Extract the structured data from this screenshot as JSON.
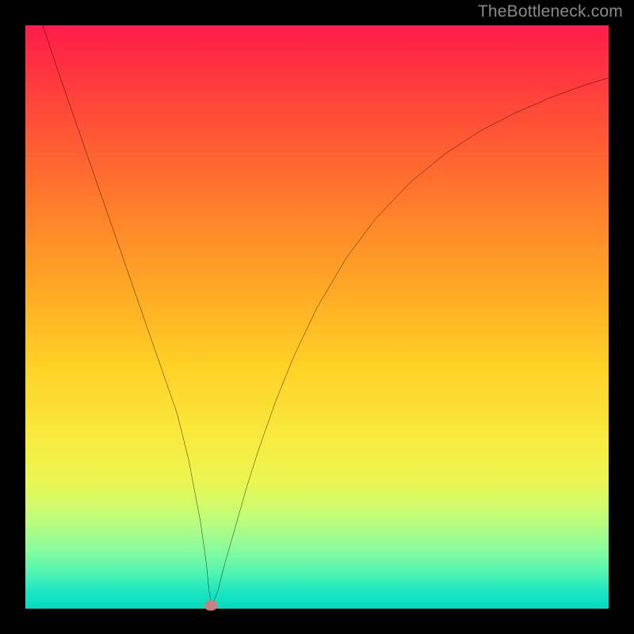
{
  "watermark": "TheBottleneck.com",
  "chart_data": {
    "type": "line",
    "title": "",
    "xlabel": "",
    "ylabel": "",
    "xlim": [
      0,
      100
    ],
    "ylim": [
      0,
      100
    ],
    "series": [
      {
        "name": "curve",
        "x": [
          3,
          6,
          10,
          14,
          18,
          22,
          26,
          28,
          30,
          31,
          31.5,
          32,
          33,
          34,
          36,
          38,
          40,
          43,
          46,
          50,
          55,
          60,
          66,
          72,
          78,
          84,
          90,
          96,
          100
        ],
        "y": [
          100,
          91,
          79.5,
          68,
          56.5,
          45,
          33.5,
          25.5,
          15,
          8,
          3,
          0.5,
          3,
          7,
          14,
          21,
          27.3,
          35.8,
          43.2,
          51.6,
          60.1,
          66.8,
          73.1,
          78.0,
          81.9,
          85.0,
          87.6,
          89.8,
          91.0
        ]
      }
    ],
    "marker": {
      "x": 31.8,
      "y": 0.5
    },
    "gradient_note": "vertical red→yellow→green gradient background inside axes"
  }
}
